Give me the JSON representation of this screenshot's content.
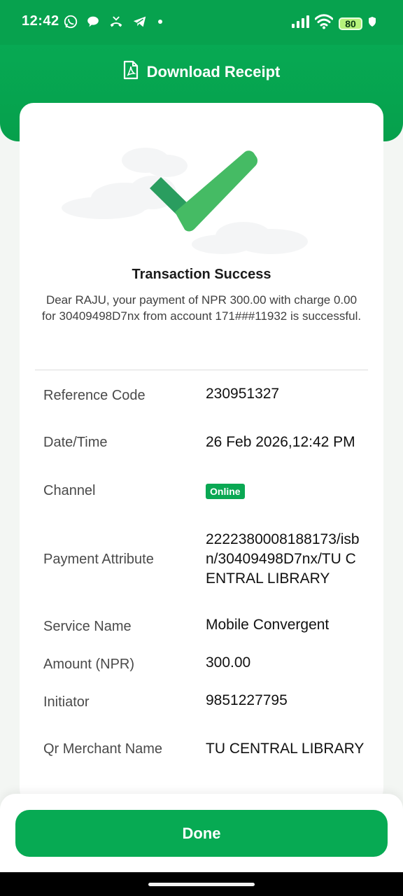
{
  "status_bar": {
    "time": "12:42",
    "battery": "80",
    "left_icons": [
      "whatsapp-icon",
      "chat-bubble-icon",
      "missed-call-icon",
      "telegram-icon",
      "dot-icon"
    ],
    "right_icons": [
      "signal-icon",
      "wifi-icon",
      "battery-icon",
      "shield-icon"
    ]
  },
  "header": {
    "download_label": "Download Receipt",
    "icon": "pdf-document-icon"
  },
  "receipt": {
    "title": "Transaction Success",
    "message": "Dear RAJU, your payment of NPR 300.00 with charge 0.00 for 30409498D7nx from account 171###11932 is successful.",
    "rows": [
      {
        "label": "Reference Code",
        "value": "230951327"
      },
      {
        "label": "Date/Time",
        "value": "26 Feb 2026,12:42 PM"
      },
      {
        "label": "Channel",
        "value": "Online"
      },
      {
        "label": "Payment Attribute",
        "value": "2222380008188173/isbn/30409498D7nx/TU CENTRAL LIBRARY"
      },
      {
        "label": "Service Name",
        "value": "Mobile Convergent"
      },
      {
        "label": "Amount (NPR)",
        "value": "300.00"
      },
      {
        "label": "Initiator",
        "value": "9851227795"
      },
      {
        "label": "Qr Merchant Name",
        "value": "TU CENTRAL LIBRARY"
      }
    ]
  },
  "footer": {
    "done_label": "Done"
  },
  "colors": {
    "primary_green": "#07aa53",
    "status_green": "#07a24e",
    "check_dark": "#2a9d5f",
    "check_light": "#45bb64"
  }
}
